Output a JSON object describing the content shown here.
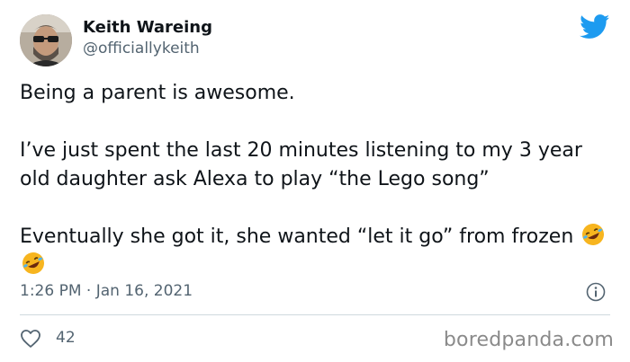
{
  "tweet": {
    "author_name": "Keith Wareing",
    "author_handle": "@officiallykeith",
    "paragraphs": [
      "Being a parent is awesome.",
      "I’ve just spent the last 20 minutes listening to my 3 year old daughter ask Alexa to play “the Lego song”",
      "Eventually she got it, she wanted “let it go” from frozen"
    ],
    "emoji": [
      "rolling-on-floor-laughing",
      "rolling-on-floor-laughing"
    ],
    "timestamp": "1:26 PM · Jan 16, 2021",
    "like_count": "42"
  },
  "icons": {
    "platform": "twitter-bird-icon",
    "info": "info-icon",
    "like": "heart-icon"
  },
  "colors": {
    "brand_blue": "#1d9bf0",
    "secondary_text": "#536471",
    "divider": "#cfd9de"
  },
  "watermark": "boredpanda.com"
}
